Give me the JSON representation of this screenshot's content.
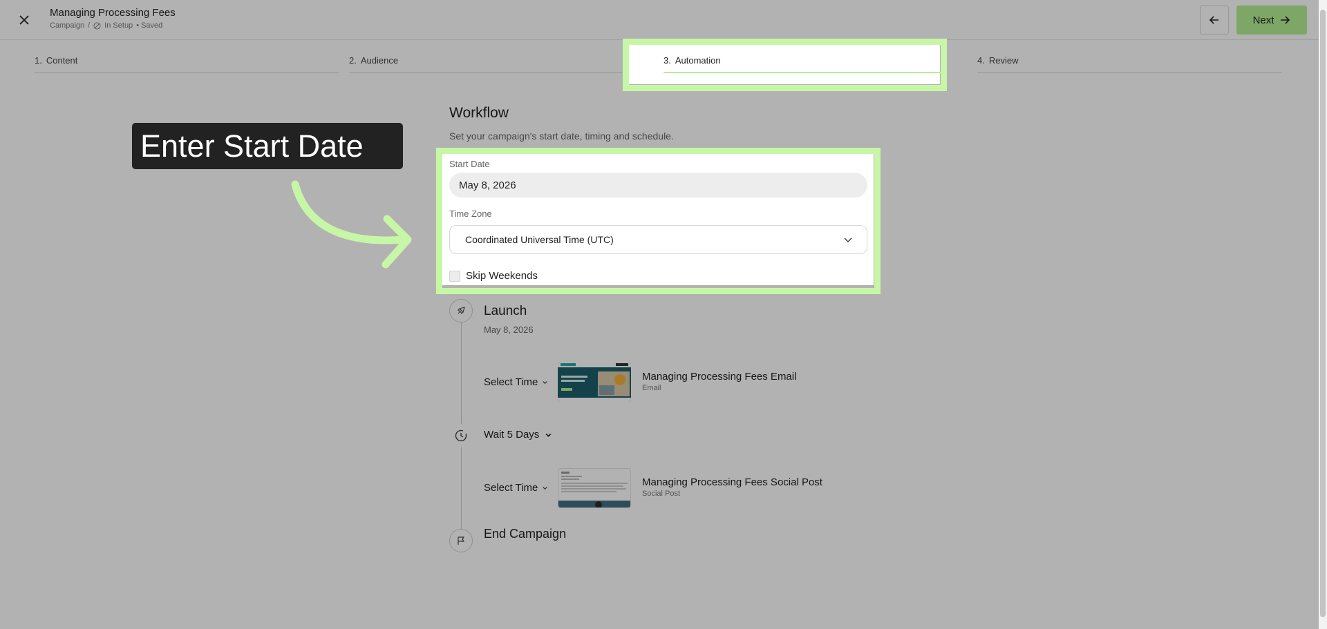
{
  "header": {
    "title": "Managing Processing Fees",
    "breadcrumb_root": "Campaign",
    "breadcrumb_sep": "/",
    "status": "In Setup",
    "saved": "• Saved",
    "next_label": "Next"
  },
  "steps": [
    {
      "num": "1.",
      "label": "Content"
    },
    {
      "num": "2.",
      "label": "Audience"
    },
    {
      "num": "3.",
      "label": "Automation"
    },
    {
      "num": "4.",
      "label": "Review"
    }
  ],
  "workflow": {
    "title": "Workflow",
    "subtitle": "Set your campaign's start date, timing and schedule.",
    "start_date_label": "Start Date",
    "start_date_value": "May 8, 2026",
    "timezone_label": "Time Zone",
    "timezone_value": "Coordinated Universal Time (UTC)",
    "skip_weekends_label": "Skip Weekends"
  },
  "timeline": {
    "launch_title": "Launch",
    "launch_date": "May 8, 2026",
    "items": [
      {
        "select_time": "Select Time",
        "asset_title": "Managing Processing Fees Email",
        "asset_type": "Email"
      },
      {
        "select_time": "Select Time",
        "asset_title": "Managing Processing Fees Social Post",
        "asset_type": "Social Post"
      }
    ],
    "wait_label": "Wait 5 Days",
    "end_title": "End Campaign"
  },
  "callout": {
    "text": "Enter Start Date"
  },
  "colors": {
    "accent": "#b5ef94",
    "highlight": "#c7f7a6",
    "callout_bg": "#222222"
  }
}
